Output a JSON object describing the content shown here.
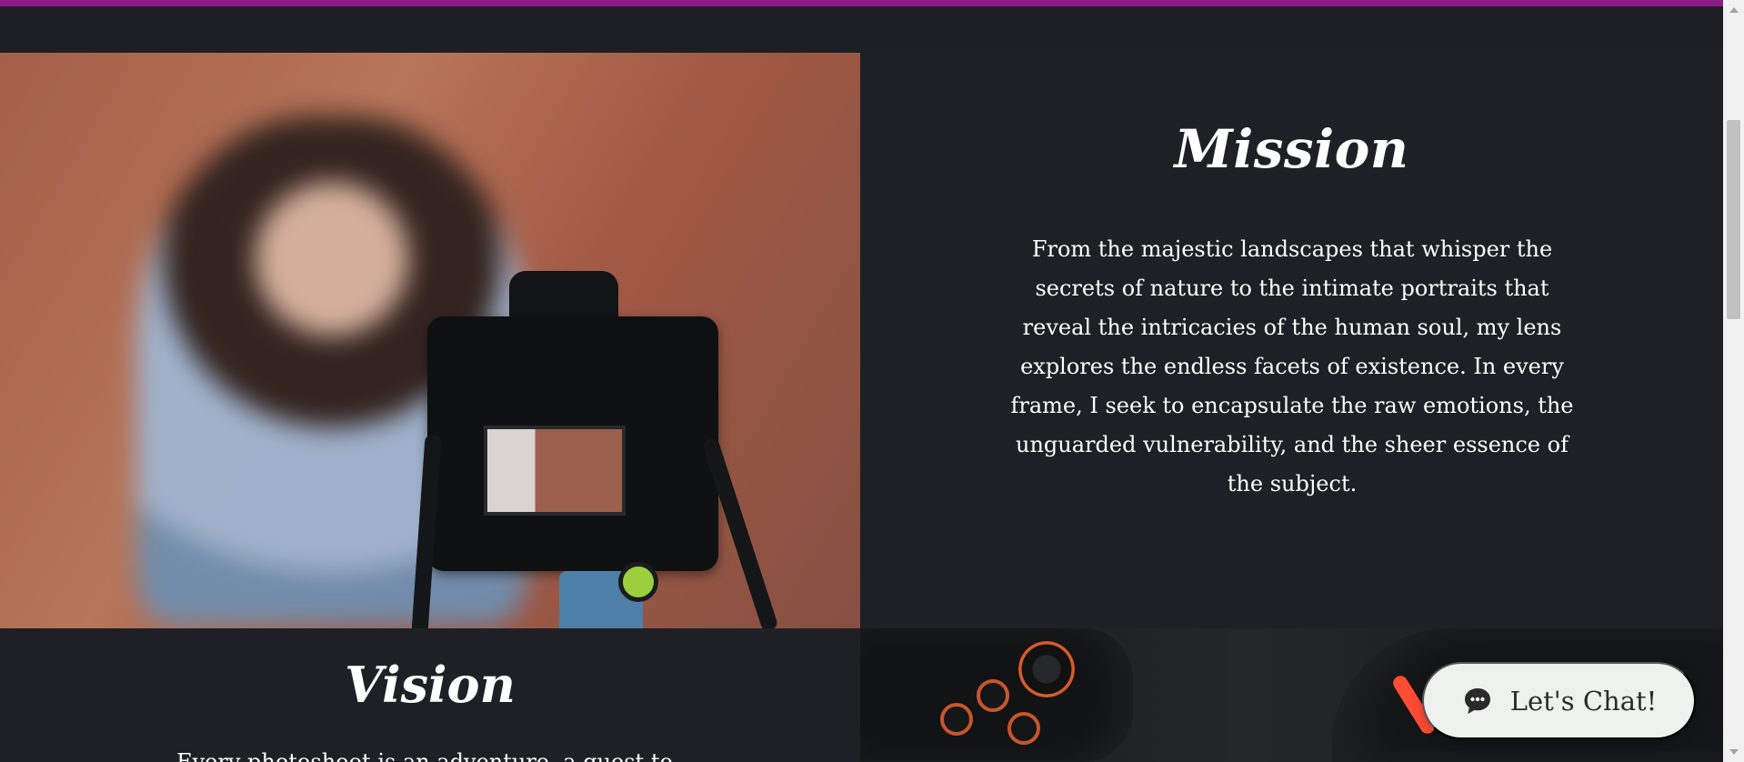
{
  "mission": {
    "heading": "Mission",
    "text": "From the majestic landscapes that whisper the secrets of nature to the intimate portraits that reveal the intricacies of the human soul, my lens explores the endless facets of existence. In every frame, I seek to encapsulate the raw emotions, the unguarded vulnerability, and the sheer essence of the subject."
  },
  "vision": {
    "heading": "Vision",
    "partial_text": "Every photoshoot is an adventure, a quest to"
  },
  "chat": {
    "label": "Let's Chat!",
    "icon": "chat-bubble-icon"
  },
  "colors": {
    "top_accent": "#8b1a8b",
    "background": "#1e2026",
    "chat_background": "#eef1ed"
  }
}
